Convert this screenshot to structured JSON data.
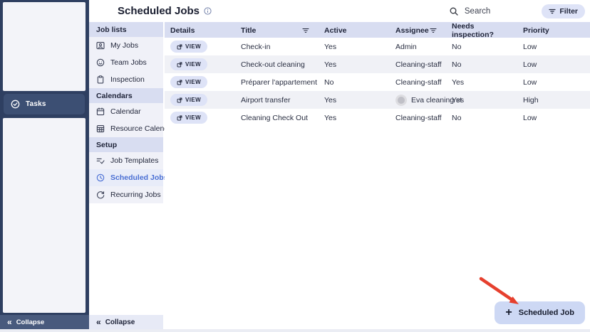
{
  "header": {
    "title": "Scheduled Jobs",
    "search_label": "Search",
    "filter_label": "Filter"
  },
  "left_rail": {
    "tasks_label": "Tasks",
    "collapse_label": "Collapse",
    "collapse_icon": "«"
  },
  "sidebar": {
    "sections": [
      {
        "label": "Job lists",
        "items": [
          {
            "label": "My Jobs"
          },
          {
            "label": "Team Jobs"
          },
          {
            "label": "Inspection"
          }
        ]
      },
      {
        "label": "Calendars",
        "items": [
          {
            "label": "Calendar"
          },
          {
            "label": "Resource Calendar"
          }
        ]
      },
      {
        "label": "Setup",
        "items": [
          {
            "label": "Job Templates"
          },
          {
            "label": "Scheduled Jobs",
            "selected": true
          },
          {
            "label": "Recurring Jobs"
          }
        ]
      }
    ],
    "collapse_label": "Collapse",
    "collapse_icon": "«"
  },
  "table": {
    "columns": [
      "Details",
      "Title",
      "Active",
      "Assignee",
      "Needs inspection?",
      "Priority"
    ],
    "view_label": "VIEW",
    "rows": [
      {
        "title": "Check-in",
        "active": "Yes",
        "assignee": "Admin",
        "needs_inspection": "No",
        "priority": "Low"
      },
      {
        "title": "Check-out cleaning",
        "active": "Yes",
        "assignee": "Cleaning-staff",
        "needs_inspection": "No",
        "priority": "Low"
      },
      {
        "title": "Préparer l'appartement",
        "active": "No",
        "assignee": "Cleaning-staff",
        "needs_inspection": "Yes",
        "priority": "Low"
      },
      {
        "title": "Airport transfer",
        "active": "Yes",
        "assignee": "Eva cleaning st",
        "needs_inspection": "Yes",
        "priority": "High",
        "has_avatar": true
      },
      {
        "title": "Cleaning Check Out",
        "active": "Yes",
        "assignee": "Cleaning-staff",
        "needs_inspection": "No",
        "priority": "Low"
      }
    ]
  },
  "fab": {
    "plus": "+",
    "label": "Scheduled Job"
  },
  "colors": {
    "navy": "#2e3f61",
    "accent_blue": "#4a6fd4",
    "header_lavender": "#d8ddf1",
    "pill_lavender": "#dee3f7",
    "fab_lavender": "#cdd8f4",
    "annotation_red": "#e6402e"
  }
}
